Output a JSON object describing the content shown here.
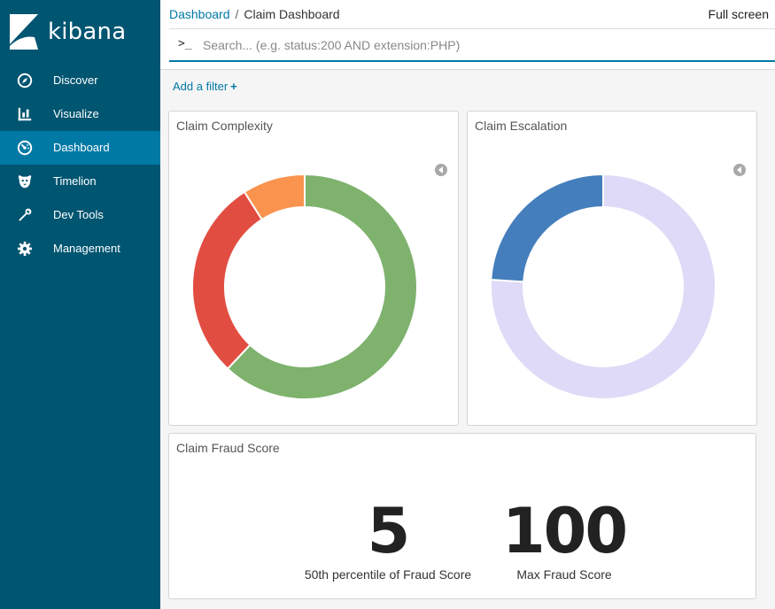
{
  "app": {
    "logo_text": "kibana"
  },
  "sidebar": {
    "items": [
      {
        "label": "Discover",
        "icon": "compass-icon"
      },
      {
        "label": "Visualize",
        "icon": "bar-chart-icon"
      },
      {
        "label": "Dashboard",
        "icon": "dashboard-icon",
        "active": true
      },
      {
        "label": "Timelion",
        "icon": "timelion-icon"
      },
      {
        "label": "Dev Tools",
        "icon": "wrench-icon"
      },
      {
        "label": "Management",
        "icon": "gear-icon"
      }
    ]
  },
  "header": {
    "breadcrumb_root": "Dashboard",
    "breadcrumb_current": "Claim Dashboard",
    "full_screen": "Full screen",
    "search_prompt": ">_",
    "search_placeholder": "Search... (e.g. status:200 AND extension:PHP)"
  },
  "filterbar": {
    "add_filter": "Add a filter",
    "add_icon": "+"
  },
  "panels": {
    "complexity": {
      "title": "Claim Complexity"
    },
    "escalation": {
      "title": "Claim Escalation"
    },
    "fraud": {
      "title": "Claim Fraud Score",
      "metrics": [
        {
          "value": "5",
          "label": "50th percentile of Fraud Score"
        },
        {
          "value": "100",
          "label": "Max Fraud Score"
        }
      ]
    }
  },
  "chart_data": [
    {
      "type": "pie",
      "donut": true,
      "slices": [
        {
          "value": 62,
          "color": "#7eb26d"
        },
        {
          "value": 29,
          "color": "#e24d42"
        },
        {
          "value": 9,
          "color": "#f9934e"
        }
      ]
    },
    {
      "type": "pie",
      "donut": true,
      "slices": [
        {
          "value": 76,
          "color": "#dedaf7"
        },
        {
          "value": 24,
          "color": "#447ebc"
        }
      ]
    }
  ]
}
